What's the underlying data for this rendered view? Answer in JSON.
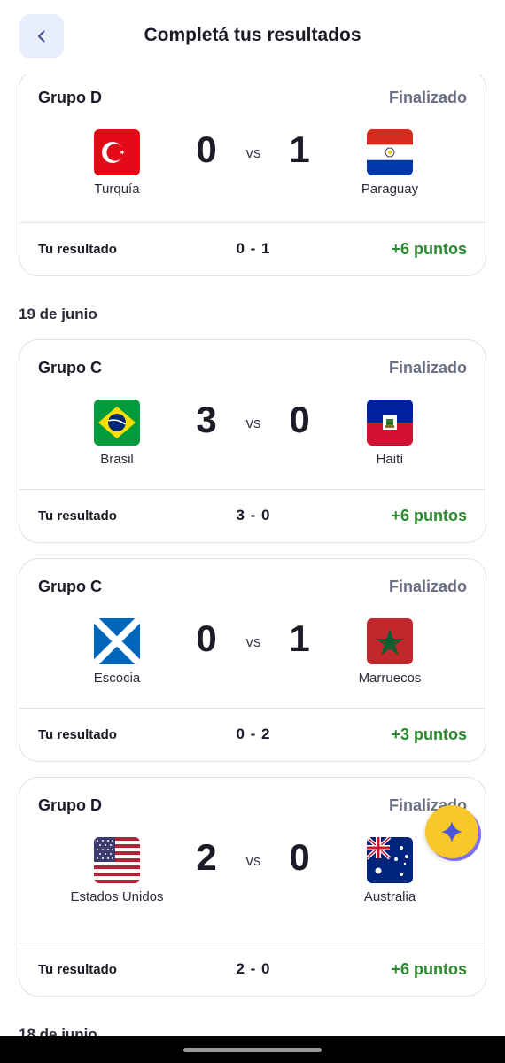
{
  "header": {
    "title": "Completá tus resultados",
    "back_icon": "chevron-left-icon"
  },
  "labels": {
    "vs": "vs",
    "your_result": "Tu resultado"
  },
  "colors": {
    "points": "#2a8a2e",
    "status": "#6b6f85",
    "back_bg": "#e8eefc",
    "fab": "#f8c82a"
  },
  "dates": [
    "19 de junio",
    "18 de junio"
  ],
  "matches": [
    {
      "group": "Grupo D",
      "status": "Finalizado",
      "home": {
        "name": "Turquía",
        "flag": "turkey-flag-icon",
        "score": "0"
      },
      "away": {
        "name": "Paraguay",
        "flag": "paraguay-flag-icon",
        "score": "1"
      },
      "your_result": "0 - 1",
      "points": "+6 puntos"
    },
    {
      "group": "Grupo C",
      "status": "Finalizado",
      "home": {
        "name": "Brasil",
        "flag": "brazil-flag-icon",
        "score": "3"
      },
      "away": {
        "name": "Haití",
        "flag": "haiti-flag-icon",
        "score": "0"
      },
      "your_result": "3 - 0",
      "points": "+6 puntos"
    },
    {
      "group": "Grupo C",
      "status": "Finalizado",
      "home": {
        "name": "Escocia",
        "flag": "scotland-flag-icon",
        "score": "0"
      },
      "away": {
        "name": "Marruecos",
        "flag": "morocco-flag-icon",
        "score": "1"
      },
      "your_result": "0 - 2",
      "points": "+3 puntos"
    },
    {
      "group": "Grupo D",
      "status": "Finalizado",
      "home": {
        "name": "Estados Unidos",
        "flag": "usa-flag-icon",
        "score": "2"
      },
      "away": {
        "name": "Australia",
        "flag": "australia-flag-icon",
        "score": "0"
      },
      "your_result": "2 - 0",
      "points": "+6 puntos"
    }
  ],
  "fab": {
    "icon": "sparkle-icon"
  }
}
